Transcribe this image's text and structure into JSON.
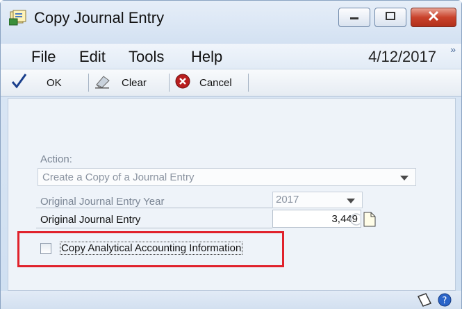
{
  "window": {
    "title": "Copy Journal Entry"
  },
  "menu": {
    "items": [
      "File",
      "Edit",
      "Tools",
      "Help"
    ],
    "date": "4/12/2017",
    "more": "»"
  },
  "toolbar": {
    "ok_label": "OK",
    "clear_label": "Clear",
    "cancel_label": "Cancel"
  },
  "form": {
    "action_label": "Action:",
    "action_value": "Create a Copy of a Journal Entry",
    "year_label": "Original Journal Entry Year",
    "year_value": "2017",
    "entry_label": "Original Journal Entry",
    "entry_value": "3,449",
    "copy_analytical_label": "Copy Analytical Accounting Information",
    "copy_analytical_checked": false
  },
  "colors": {
    "highlight": "#e0212b",
    "accent": "#1a3f8c"
  },
  "icons": [
    "app-icon",
    "minimize-icon",
    "maximize-icon",
    "close-icon",
    "checkmark-icon",
    "eraser-icon",
    "cancel-icon",
    "lookup-icon",
    "note-icon",
    "notes-icon",
    "help-icon"
  ]
}
